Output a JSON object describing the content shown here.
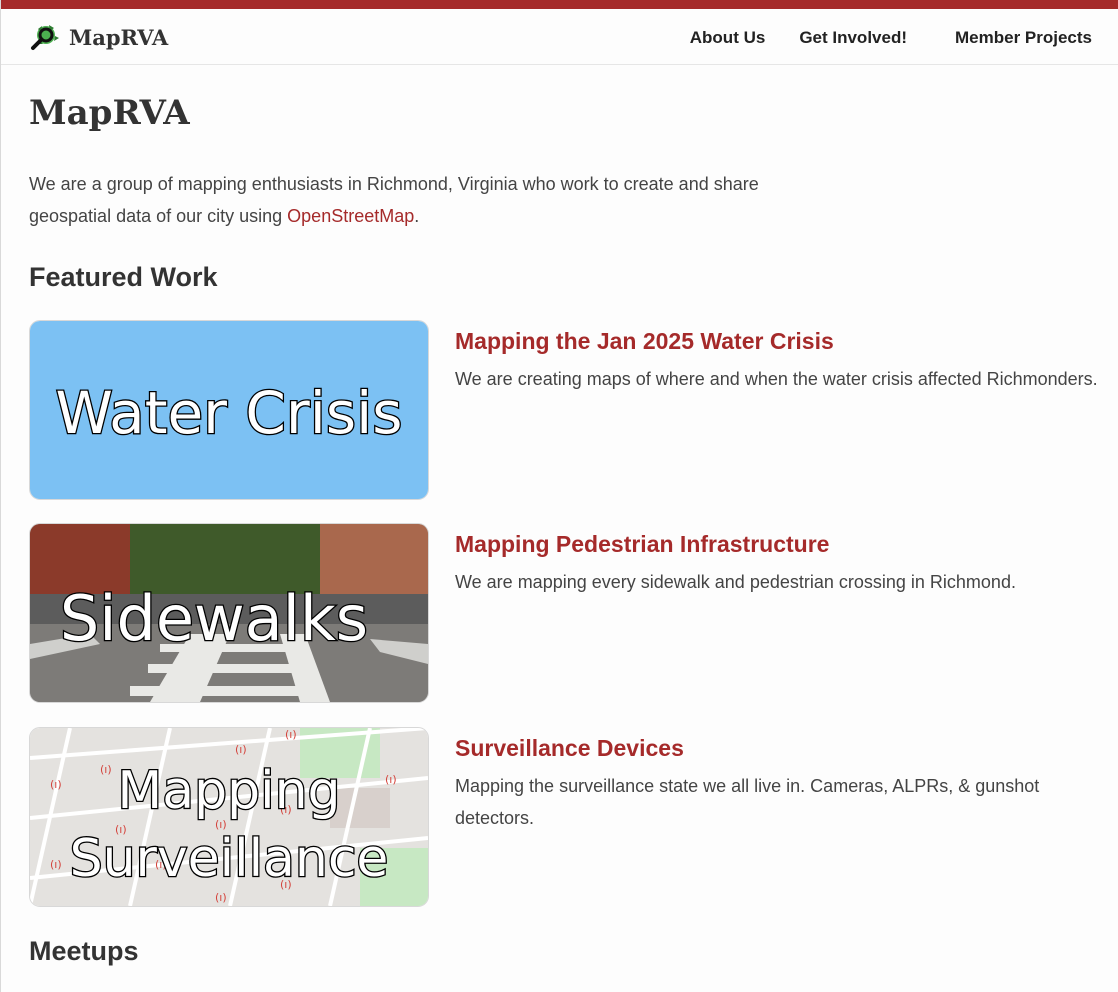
{
  "header": {
    "logo_text": "MapRVA",
    "nav": [
      {
        "label": "About Us"
      },
      {
        "label": "Get Involved!"
      },
      {
        "label": "Member Projects"
      }
    ]
  },
  "main": {
    "title": "MapRVA",
    "intro_text": "We are a group of mapping enthusiasts in Richmond, Virginia who work to create and share geospatial data of our city using ",
    "intro_link": "OpenStreetMap",
    "intro_end": ".",
    "featured_heading": "Featured Work",
    "meetups_heading": "Meetups"
  },
  "projects": [
    {
      "image_text": "Water Crisis",
      "title": "Mapping the Jan 2025 Water Crisis",
      "description": "We are creating maps of where and when the water crisis affected Richmonders."
    },
    {
      "image_text": "Sidewalks",
      "title": "Mapping Pedestrian Infrastructure",
      "description": "We are mapping every sidewalk and pedestrian crossing in Richmond."
    },
    {
      "image_text_line1": "Mapping",
      "image_text_line2": "Surveillance",
      "title": "Surveillance Devices",
      "description": "Mapping the surveillance state we all live in. Cameras, ALPRs, & gunshot detectors."
    }
  ],
  "colors": {
    "accent": "#a52a2a",
    "water_bg": "#7cc1f3"
  }
}
